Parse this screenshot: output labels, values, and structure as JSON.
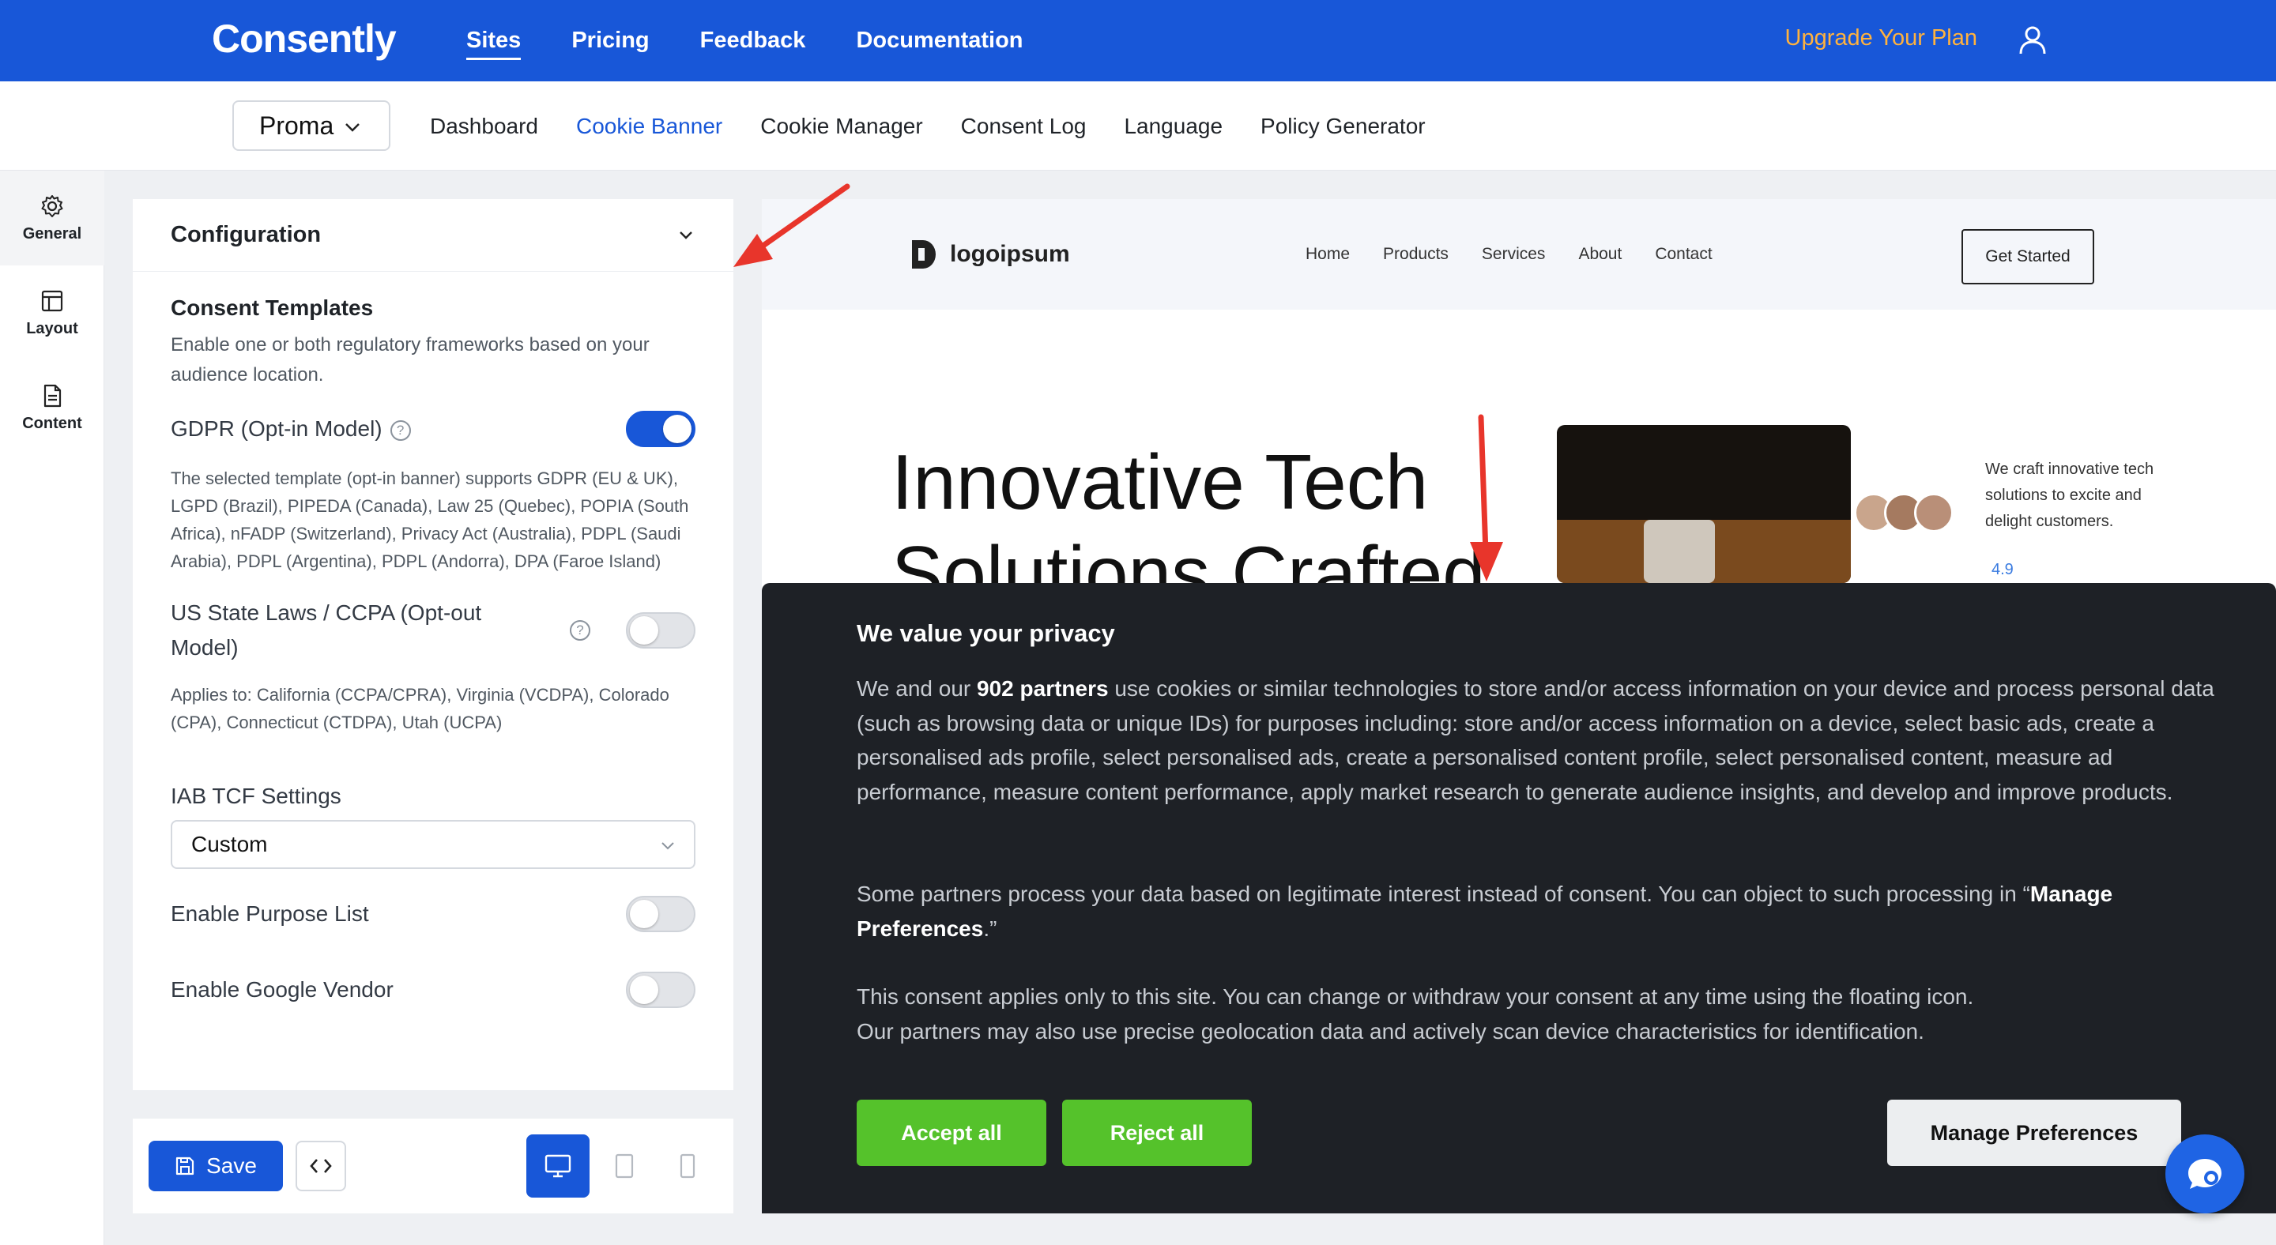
{
  "app": {
    "brand": "Consently",
    "nav": [
      "Sites",
      "Pricing",
      "Feedback",
      "Documentation"
    ],
    "active_nav": "Sites",
    "upgrade_label": "Upgrade Your Plan"
  },
  "subnav": {
    "site": "Proma",
    "tabs": [
      "Dashboard",
      "Cookie Banner",
      "Cookie Manager",
      "Consent Log",
      "Language",
      "Policy Generator"
    ],
    "active_tab": "Cookie Banner"
  },
  "rail": {
    "items": [
      {
        "label": "General",
        "icon": "gear-icon"
      },
      {
        "label": "Layout",
        "icon": "layout-icon"
      },
      {
        "label": "Content",
        "icon": "document-icon"
      }
    ],
    "active": "General"
  },
  "config": {
    "title": "Configuration",
    "consent_templates": {
      "title": "Consent Templates",
      "description": "Enable one or both regulatory frameworks based on your audience location."
    },
    "gdpr": {
      "label": "GDPR (Opt-in Model)",
      "enabled": true,
      "note": "The selected template (opt-in banner) supports GDPR (EU & UK), LGPD (Brazil), PIPEDA (Canada), Law 25 (Quebec), POPIA (South Africa), nFADP (Switzerland), Privacy Act (Australia), PDPL (Saudi Arabia), PDPL (Argentina), PDPL (Andorra), DPA (Faroe Island)"
    },
    "ccpa": {
      "label": "US State Laws / CCPA (Opt-out Model)",
      "enabled": false,
      "note": "Applies to: California (CCPA/CPRA), Virginia (VCDPA), Colorado (CPA), Connecticut (CTDPA), Utah (UCPA)"
    },
    "iab": {
      "label": "IAB TCF Settings",
      "selected": "Custom"
    },
    "purpose_list": {
      "label": "Enable Purpose List",
      "enabled": false
    },
    "google_vendor": {
      "label": "Enable Google Vendor",
      "enabled": false
    }
  },
  "bottom": {
    "save_label": "Save",
    "device": "desktop"
  },
  "preview": {
    "logo": "logoipsum",
    "nav": [
      "Home",
      "Products",
      "Services",
      "About",
      "Contact"
    ],
    "cta": "Get Started",
    "hero_line1": "Innovative Tech",
    "hero_line2": "Solutions Crafted",
    "side_text": "We craft innovative tech solutions to excite and delight customers.",
    "rating": "4.9"
  },
  "banner": {
    "title": "We value your privacy",
    "p1_pre": "We and our ",
    "p1_bold": "902 partners",
    "p1_post": " use cookies or similar technologies to store and/or access information on your device and process personal data (such as browsing data or unique IDs) for purposes including: store and/or access information on a device, select basic ads, create a personalised ads profile, select personalised ads, create a personalised content profile, select personalised content, measure ad performance, measure content performance, apply market research to generate audience insights, and develop and improve products.",
    "p2_pre": "Some partners process your data based on legitimate interest instead of consent. You can object to such processing in “",
    "p2_bold": "Manage Preferences",
    "p2_post": ".”",
    "p3_line1": "This consent applies only to this site. You can change or withdraw your consent at any time using the floating icon.",
    "p3_line2": "Our partners may also use precise geolocation data and actively scan device characteristics for identification.",
    "accept_label": "Accept all",
    "reject_label": "Reject all",
    "manage_label": "Manage Preferences"
  },
  "colors": {
    "brand_blue": "#1857d8",
    "upgrade_orange": "#ffb23e",
    "accept_green": "#55c22b",
    "banner_bg": "#1e2126",
    "annotation_red": "#e8352b"
  }
}
